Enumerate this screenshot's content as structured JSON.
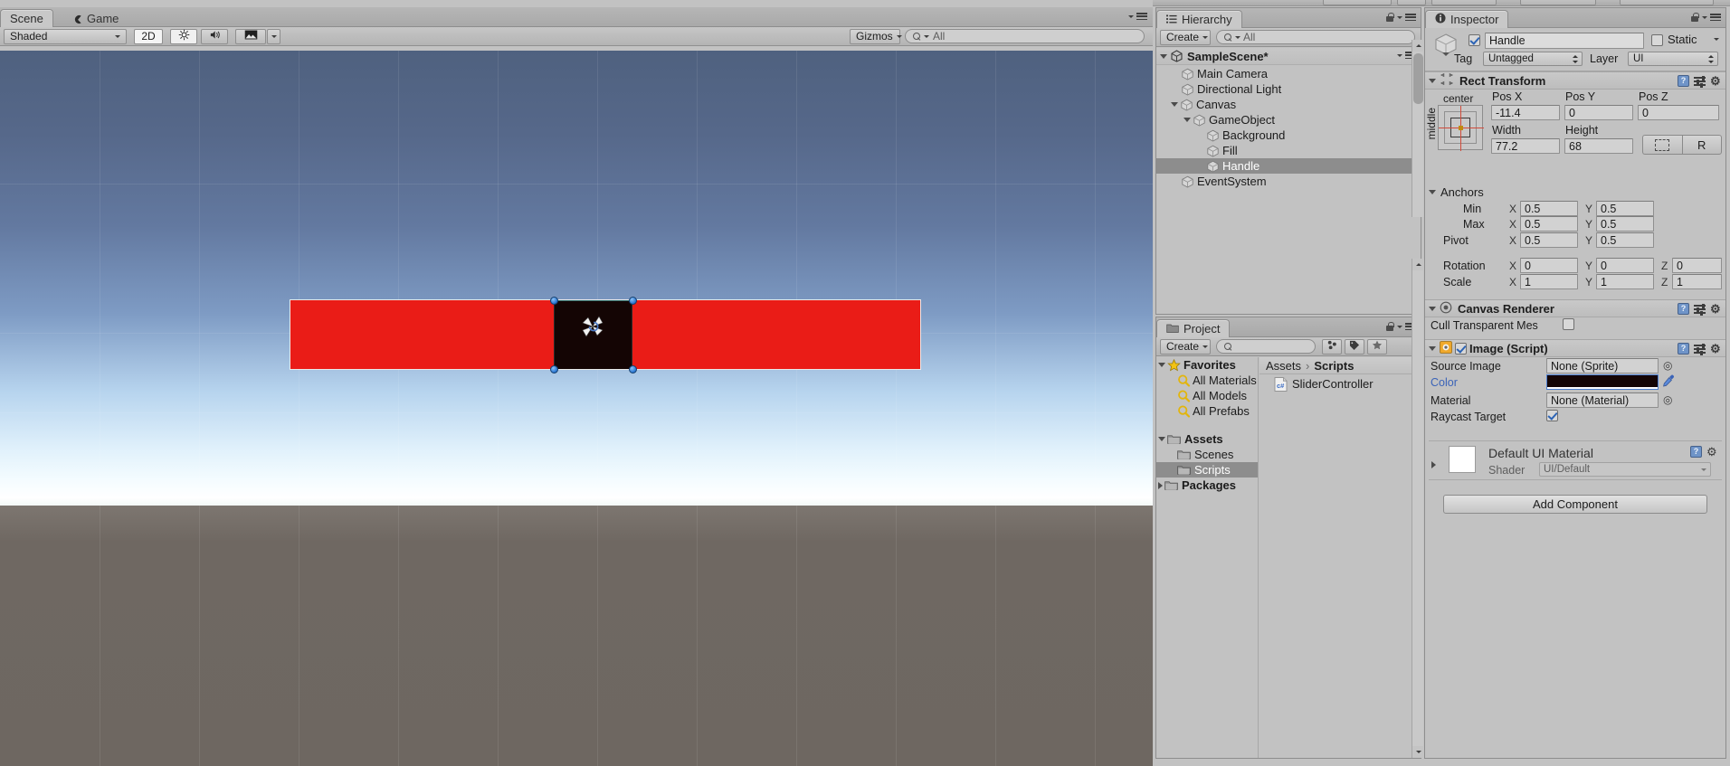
{
  "app": {
    "name": "Unity Editor"
  },
  "scene_view": {
    "tabs": [
      {
        "label": "Scene",
        "active": true,
        "icon": "scene-icon"
      },
      {
        "label": "Game",
        "active": false,
        "icon": "game-icon"
      }
    ],
    "toolbar": {
      "draw_mode": "Shaded",
      "mode_2d": "2D",
      "lighting_icon": "sun-icon",
      "audio_icon": "speaker-icon",
      "effects_icon": "image-icon",
      "gizmos_label": "Gizmos",
      "search_placeholder": "All",
      "search_value": ""
    },
    "objects": {
      "background_color": "#ea1c17",
      "handle_color": "#140504",
      "selection_outline": "#e9e9e9",
      "handle_point_color": "#2c79d4"
    }
  },
  "hierarchy": {
    "title": "Hierarchy",
    "create_label": "Create",
    "search_placeholder": "All",
    "search_value": "",
    "scene_name": "SampleScene*",
    "items": [
      {
        "label": "Main Camera",
        "depth": 1,
        "expand": "none",
        "selected": false
      },
      {
        "label": "Directional Light",
        "depth": 1,
        "expand": "none",
        "selected": false
      },
      {
        "label": "Canvas",
        "depth": 1,
        "expand": "open",
        "selected": false
      },
      {
        "label": "GameObject",
        "depth": 2,
        "expand": "open",
        "selected": false
      },
      {
        "label": "Background",
        "depth": 3,
        "expand": "none",
        "selected": false
      },
      {
        "label": "Fill",
        "depth": 3,
        "expand": "none",
        "selected": false
      },
      {
        "label": "Handle",
        "depth": 3,
        "expand": "none",
        "selected": true
      },
      {
        "label": "EventSystem",
        "depth": 1,
        "expand": "none",
        "selected": false
      }
    ]
  },
  "project": {
    "title": "Project",
    "create_label": "Create",
    "search_placeholder": "",
    "search_value": "",
    "tree": [
      {
        "label": "Favorites",
        "depth": 0,
        "expand": "open",
        "icon": "star-icon",
        "bold": true,
        "selected": false
      },
      {
        "label": "All Materials",
        "depth": 1,
        "expand": "none",
        "icon": "search-icon",
        "bold": false,
        "selected": false
      },
      {
        "label": "All Models",
        "depth": 1,
        "expand": "none",
        "icon": "search-icon",
        "bold": false,
        "selected": false
      },
      {
        "label": "All Prefabs",
        "depth": 1,
        "expand": "none",
        "icon": "search-icon",
        "bold": false,
        "selected": false
      },
      {
        "label": "",
        "depth": 0,
        "expand": "none",
        "icon": "spacer",
        "bold": false,
        "selected": false
      },
      {
        "label": "Assets",
        "depth": 0,
        "expand": "open",
        "icon": "folder-icon",
        "bold": true,
        "selected": false
      },
      {
        "label": "Scenes",
        "depth": 1,
        "expand": "none",
        "icon": "folder-icon",
        "bold": false,
        "selected": false
      },
      {
        "label": "Scripts",
        "depth": 1,
        "expand": "none",
        "icon": "folder-icon",
        "bold": false,
        "selected": true
      },
      {
        "label": "Packages",
        "depth": 0,
        "expand": "closed",
        "icon": "folder-icon",
        "bold": true,
        "selected": false
      }
    ],
    "breadcrumb": {
      "root": "Assets",
      "separator": "›",
      "current": "Scripts"
    },
    "files": [
      {
        "label": "SliderController",
        "icon": "csharp-script-icon"
      }
    ]
  },
  "inspector": {
    "title": "Inspector",
    "object_name": "Handle",
    "object_enabled": true,
    "static_label": "Static",
    "static_checked": false,
    "tag_label": "Tag",
    "tag_value": "Untagged",
    "layer_label": "Layer",
    "layer_value": "UI",
    "rect_transform": {
      "title": "Rect Transform",
      "anchor_preset_h": "center",
      "anchor_preset_v": "middle",
      "pos_x_label": "Pos X",
      "pos_x": "-11.4",
      "pos_y_label": "Pos Y",
      "pos_y": "0",
      "pos_z_label": "Pos Z",
      "pos_z": "0",
      "width_label": "Width",
      "width": "77.2",
      "height_label": "Height",
      "height": "68",
      "blueprint_label": "",
      "raw_label": "R",
      "anchors_label": "Anchors",
      "min_label": "Min",
      "min_x": "0.5",
      "min_y": "0.5",
      "max_label": "Max",
      "max_x": "0.5",
      "max_y": "0.5",
      "pivot_label": "Pivot",
      "pivot_x": "0.5",
      "pivot_y": "0.5",
      "rotation_label": "Rotation",
      "rot_x": "0",
      "rot_y": "0",
      "rot_z": "0",
      "scale_label": "Scale",
      "scale_x": "1",
      "scale_y": "1",
      "scale_z": "1",
      "axis_x": "X",
      "axis_y": "Y",
      "axis_z": "Z"
    },
    "canvas_renderer": {
      "title": "Canvas Renderer",
      "cull_label": "Cull Transparent Mes",
      "cull_checked": false
    },
    "image_script": {
      "title": "Image (Script)",
      "enabled": true,
      "source_image_label": "Source Image",
      "source_image_value": "None (Sprite)",
      "color_label": "Color",
      "color_value": "#140505",
      "material_label": "Material",
      "material_value": "None (Material)",
      "raycast_label": "Raycast Target",
      "raycast_checked": true
    },
    "material": {
      "name": "Default UI Material",
      "shader_label": "Shader",
      "shader_value": "UI/Default",
      "swatch_color": "#ffffff"
    },
    "add_component_label": "Add Component"
  }
}
